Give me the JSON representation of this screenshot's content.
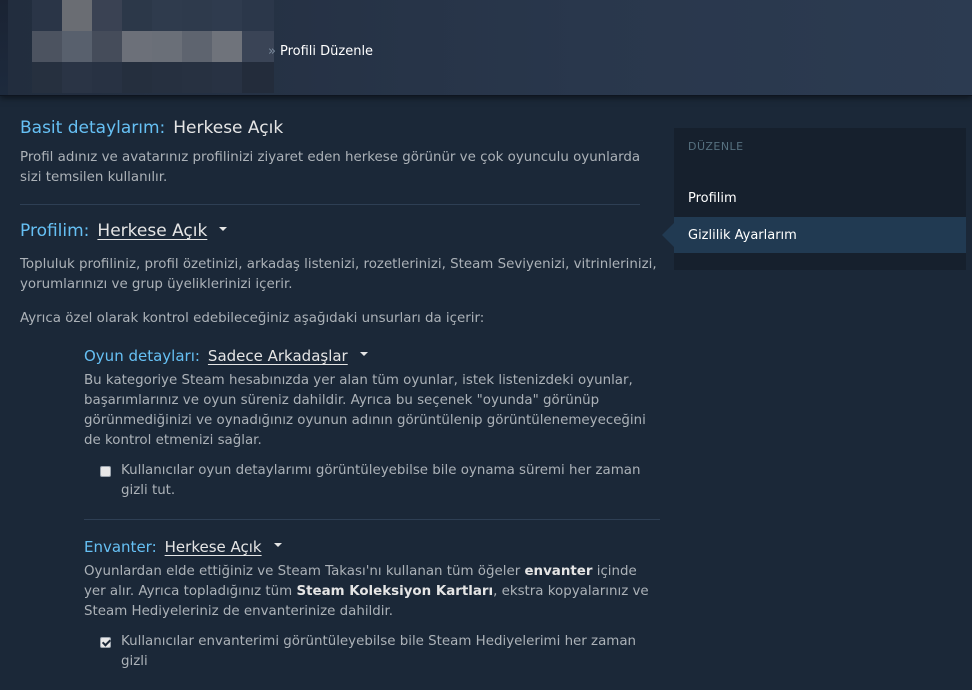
{
  "breadcrumb": {
    "separator": "»",
    "current": "Profili Düzenle"
  },
  "basic": {
    "title": "Basit detaylarım:",
    "value": "Herkese Açık",
    "desc": "Profil adınız ve avatarınız profilinizi ziyaret eden herkese görünür ve çok oyunculu oyunlarda sizi temsilen kullanılır."
  },
  "profile": {
    "title": "Profilim:",
    "value": "Herkese Açık",
    "desc": "Topluluk profiliniz, profil özetinizi, arkadaş listenizi, rozetlerinizi, Steam Seviyenizi, vitrinlerinizi, yorumlarınızı ve grup üyeliklerinizi içerir.",
    "desc2": "Ayrıca özel olarak kontrol edebileceğiniz aşağıdaki unsurları da içerir:"
  },
  "game_details": {
    "title": "Oyun detayları:",
    "value": "Sadece Arkadaşlar",
    "desc": "Bu kategoriye Steam hesabınızda yer alan tüm oyunlar, istek listenizdeki oyunlar, başarımlarınız ve oyun süreniz dahildir. Ayrıca bu seçenek \"oyunda\" görünüp görünmediğinizi ve oynadığınız oyunun adının görüntülenip görüntülenemeyeceğini de kontrol etmenizi sağlar.",
    "checkbox_label": "Kullanıcılar oyun detaylarımı görüntüleyebilse bile oynama süremi her zaman gizli tut.",
    "checked": false
  },
  "inventory": {
    "title": "Envanter:",
    "value": "Herkese Açık",
    "desc_part1": "Oyunlardan elde ettiğiniz ve Steam Takası'nı kullanan tüm öğeler ",
    "desc_bold1": "envanter",
    "desc_part2": " içinde yer alır. Ayrıca topladığınız tüm ",
    "desc_bold2": "Steam Koleksiyon Kartları",
    "desc_part3": ", ekstra kopyalarınız ve Steam Hediyeleriniz de envanterinize dahildir.",
    "checkbox_label": "Kullanıcılar envanterimi görüntüleyebilse bile Steam Hediyelerimi her zaman gizli",
    "checked": true
  },
  "sidebar": {
    "heading": "DÜZENLE",
    "items": [
      {
        "label": "Profilim",
        "active": false
      },
      {
        "label": "Gizlilik Ayarlarım",
        "active": true
      }
    ]
  },
  "colors": {
    "accent": "#66c0f4",
    "background": "#1b2838",
    "sidebar": "#16202d",
    "active": "#213a52"
  }
}
